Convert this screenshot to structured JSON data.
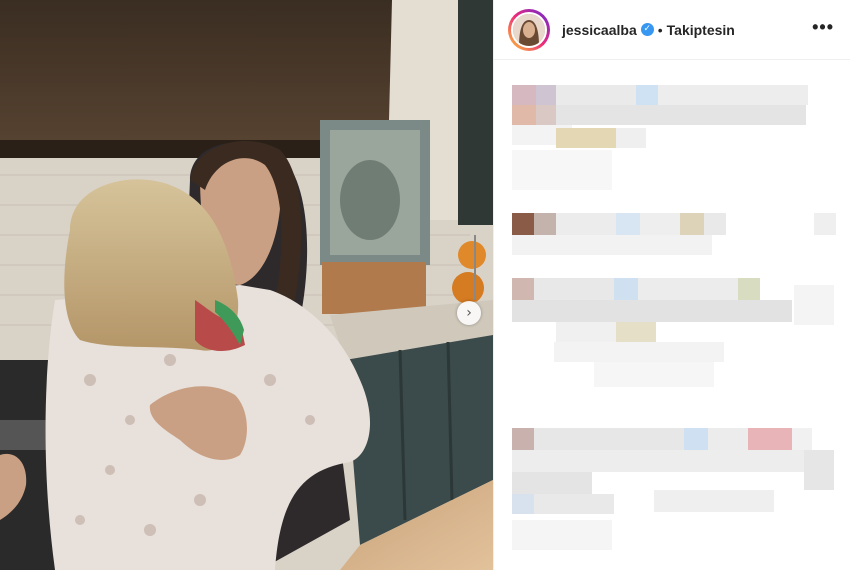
{
  "post": {
    "username": "jessicaalba",
    "verified_icon": "verified-badge-icon",
    "separator": "•",
    "follow_label": "Takiptesin",
    "more_icon": "more-options-icon",
    "more_glyph": "•••"
  },
  "photo": {
    "next_glyph": "›"
  },
  "colors": {
    "verified": "#3897f0",
    "text": "#262626",
    "border": "#efefef"
  }
}
